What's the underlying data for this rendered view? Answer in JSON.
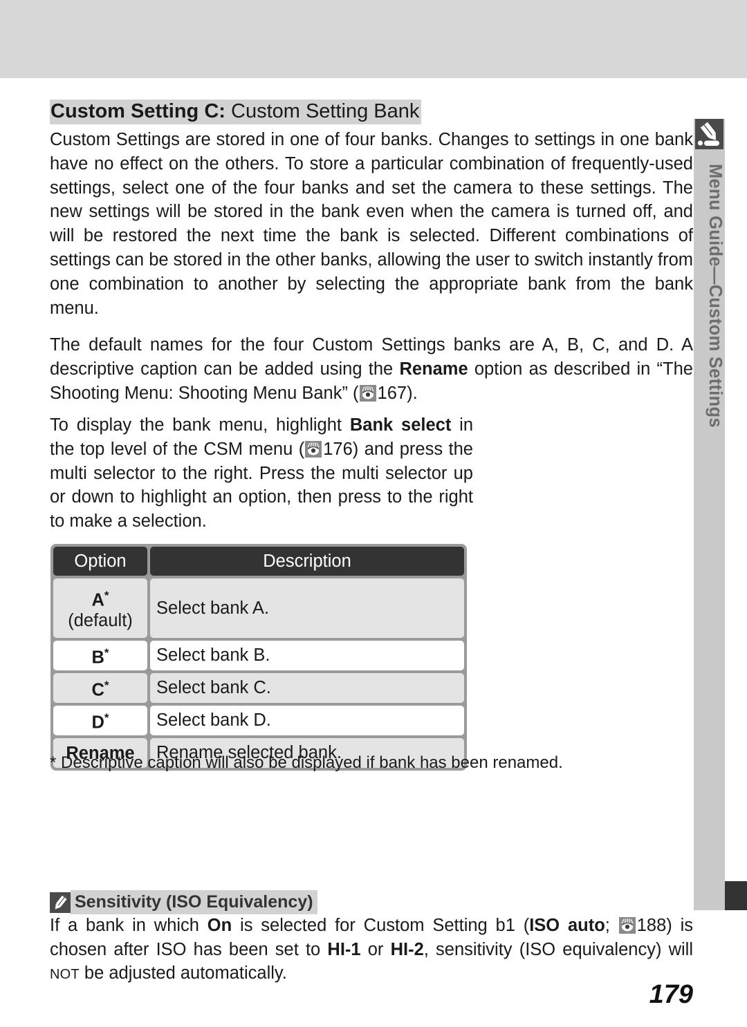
{
  "page": {
    "number": "179",
    "side_tab_label": "Menu Guide—Custom Settings",
    "side_tab_icon": "pencil-note-icon"
  },
  "heading": {
    "bold_part": "Custom Setting C:",
    "regular_part": " Custom Setting Bank"
  },
  "paragraphs": {
    "p1": "Custom Settings are stored in one of four banks.  Changes to settings in one bank have no effect on the others.  To store a particular combination of frequently-used settings, select one of the four banks and set the camera to these settings.  The new settings will be stored in the bank even when the camera is turned off, and will be restored the next time the bank is selected.  Different combinations of settings can be stored in the other banks, allowing the user to switch instantly from one combination to another by selecting the appropriate bank from the bank menu.",
    "p2_a": "The default names for the four Custom Settings banks are A, B, C, and D.  A descriptive caption can be added using the ",
    "p2_bold": "Rename",
    "p2_b": " option as described in “The Shooting Menu: Shooting Menu Bank” (",
    "p2_ref": "167",
    "p2_c": ").",
    "p3_a": "To display the bank menu, highlight ",
    "p3_bold": "Bank select",
    "p3_b": " in the top level of the CSM menu (",
    "p3_ref": "176",
    "p3_c": ") and press the multi selector to the right.  Press the multi selector up or down to highlight an option, then press to the right to make a selection."
  },
  "table": {
    "headers": {
      "option": "Option",
      "description": "Description"
    },
    "rows": [
      {
        "option": "A",
        "marker": "*",
        "option_sub": "(default)",
        "description": "Select bank A."
      },
      {
        "option": "B",
        "marker": "*",
        "option_sub": "",
        "description": "Select bank B."
      },
      {
        "option": "C",
        "marker": "*",
        "option_sub": "",
        "description": "Select bank C."
      },
      {
        "option": "D",
        "marker": "*",
        "option_sub": "",
        "description": "Select bank D."
      },
      {
        "option": "Rename",
        "marker": "",
        "option_sub": "",
        "description": "Rename selected bank."
      }
    ],
    "footnote": "* Descriptive caption will also be displayed if bank has been renamed."
  },
  "note": {
    "icon": "pencil-note-icon",
    "title": "Sensitivity (ISO Equivalency)",
    "body_a": "If a bank in which ",
    "body_on": "On",
    "body_b": " is selected for Custom Setting b1 (",
    "body_isoauto": "ISO auto",
    "body_c": "; ",
    "body_ref": "188",
    "body_d": ") is chosen after ISO has been set to ",
    "body_hi1": "HI-1",
    "body_e": " or ",
    "body_hi2": "HI-2",
    "body_f": ", sensitivity (ISO equivalency) will ",
    "body_not": "NOT",
    "body_g": " be adjusted automatically."
  },
  "colors": {
    "top_band": "#d7d7d7",
    "side_tab": "#c9c9c9",
    "table_header": "#333333",
    "row_shade": "#e4e4e4",
    "highlight": "#d2d2d2"
  }
}
